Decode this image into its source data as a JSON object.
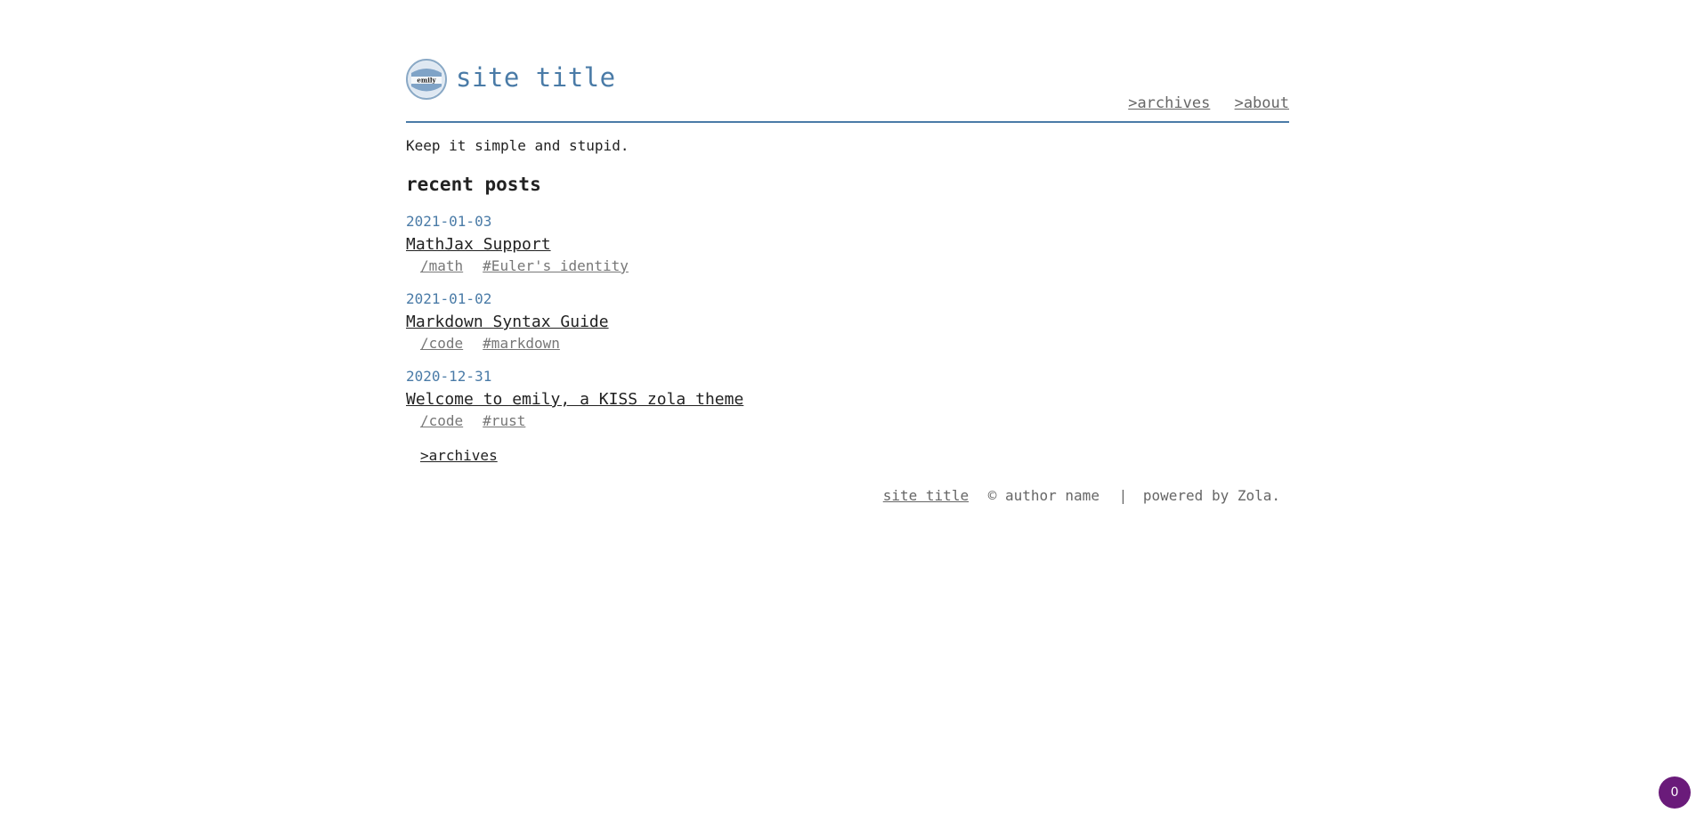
{
  "header": {
    "logo_text": "emily",
    "site_title": "site title",
    "nav": [
      {
        "label": ">archives"
      },
      {
        "label": ">about"
      }
    ]
  },
  "tagline": "Keep it simple and stupid.",
  "recent_posts": {
    "heading": "recent posts",
    "items": [
      {
        "date": "2021-01-03",
        "title": "MathJax Support",
        "category": "/math",
        "tag": "#Euler's identity"
      },
      {
        "date": "2021-01-02",
        "title": "Markdown Syntax Guide",
        "category": "/code",
        "tag": "#markdown"
      },
      {
        "date": "2020-12-31",
        "title": "Welcome to emily, a KISS zola theme",
        "category": "/code",
        "tag": "#rust"
      }
    ],
    "more_link": ">archives"
  },
  "footer": {
    "site_link": "site title",
    "copyright": "© author name",
    "separator": "|",
    "powered_by": "powered by Zola."
  },
  "badge": {
    "count": "0"
  },
  "colors": {
    "accent": "#4a7ba7",
    "text": "#222222",
    "muted": "#666666",
    "badge": "#6a1b7a"
  }
}
